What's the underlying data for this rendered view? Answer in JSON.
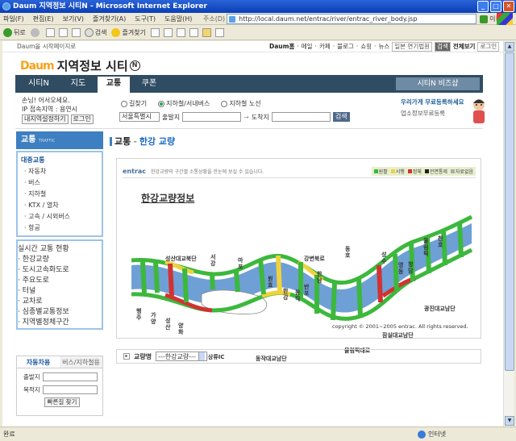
{
  "window": {
    "title": "Daum 지역정보 시티N - Microsoft Internet Explorer"
  },
  "menu": [
    "파일(F)",
    "편집(E)",
    "보기(V)",
    "즐겨찾기(A)",
    "도구(T)",
    "도움말(H)"
  ],
  "address": {
    "label": "주소(D)",
    "url": "http://local.daum.net/entrac/river/entrac_river_body.jsp",
    "go": "이동"
  },
  "toolbar": {
    "back": "뒤로",
    "search": "검색",
    "favorites": "즐겨찾기"
  },
  "status": {
    "text": "완료",
    "zone": "인터넷"
  },
  "page": {
    "top_left": "Daum을 시작페이지로",
    "top_links": [
      "Daum홈",
      "메일",
      "카페",
      "블로그",
      "쇼핑",
      "뉴스",
      "일본 연기법원",
      "검색",
      "전체보기",
      "로그인"
    ],
    "logo_brand": "Daum",
    "logo_title": "지역정보 시티",
    "logo_n": "N",
    "nav": [
      {
        "label": "시티N"
      },
      {
        "label": "지도"
      },
      {
        "label": "교통"
      },
      {
        "label": "쿠폰"
      }
    ],
    "nav_right": "시티N 비즈샵",
    "greeting": "손님! 어서오세요.",
    "location": "IP 접속지역 : 용연시",
    "loc_btn1": "내지역설정하기",
    "loc_btn2": "로그인",
    "search_radios": [
      "길찾기",
      "지하철/서내버스",
      "지하철 노선"
    ],
    "search_city": "서울특별시",
    "search_from": "출발지",
    "search_to": "도착지",
    "search_btn": "검색",
    "promo_title": "우리가게 무료등록하세요",
    "promo_sub": "업소정보무료등록",
    "side_header": "교통",
    "side_header_en": "TRAFFIC",
    "side_sec1": "대중교통",
    "side_items1": [
      "자동차",
      "버스",
      "지하철",
      "KTX / 열차",
      "고속 / 시외버스",
      "항공"
    ],
    "side_sec2": "실시간 교통 현황",
    "side_items2": [
      "한강교량",
      "도시고속화도로",
      "주요도로",
      "터널",
      "교차로",
      "심종별교통정보",
      "지역별정체구간"
    ],
    "route_tabs": [
      "자동차용",
      "버스/지하철용"
    ],
    "route_from": "출발지",
    "route_to": "목적지",
    "route_btn": "빠른길 찾기",
    "crumb_main": "교통",
    "crumb_sep": "-",
    "crumb_sub": "한강 교량",
    "map_brand": "entrac",
    "map_note": "한강교량의 구간별 소통상황을 한눈에 보실 수 있습니다.",
    "legend": [
      {
        "label": "원활",
        "color": "#3cb83c"
      },
      {
        "label": "서행",
        "color": "#f0d23c"
      },
      {
        "label": "정체",
        "color": "#d23232"
      },
      {
        "label": "전면통제",
        "color": "#222222"
      },
      {
        "label": "자료없음",
        "color": "#aaaaaa"
      }
    ],
    "map_title": "한강교량정보",
    "map_labels": [
      "성산대교북단",
      "서강",
      "마포",
      "원효",
      "한강",
      "동작",
      "반포",
      "한남",
      "강변북로",
      "동호",
      "성수",
      "영동",
      "청담",
      "올림픽",
      "천호",
      "행주",
      "가양",
      "성산",
      "양화",
      "여의상류IC",
      "동작대교남단",
      "올림픽대로",
      "잠실대교남단",
      "광진대교남단"
    ],
    "copyright": "copyright © 2001~2005 entrac. All rights reserved.",
    "bridge_label": "교량명",
    "bridge_select": "---한강교량---"
  }
}
